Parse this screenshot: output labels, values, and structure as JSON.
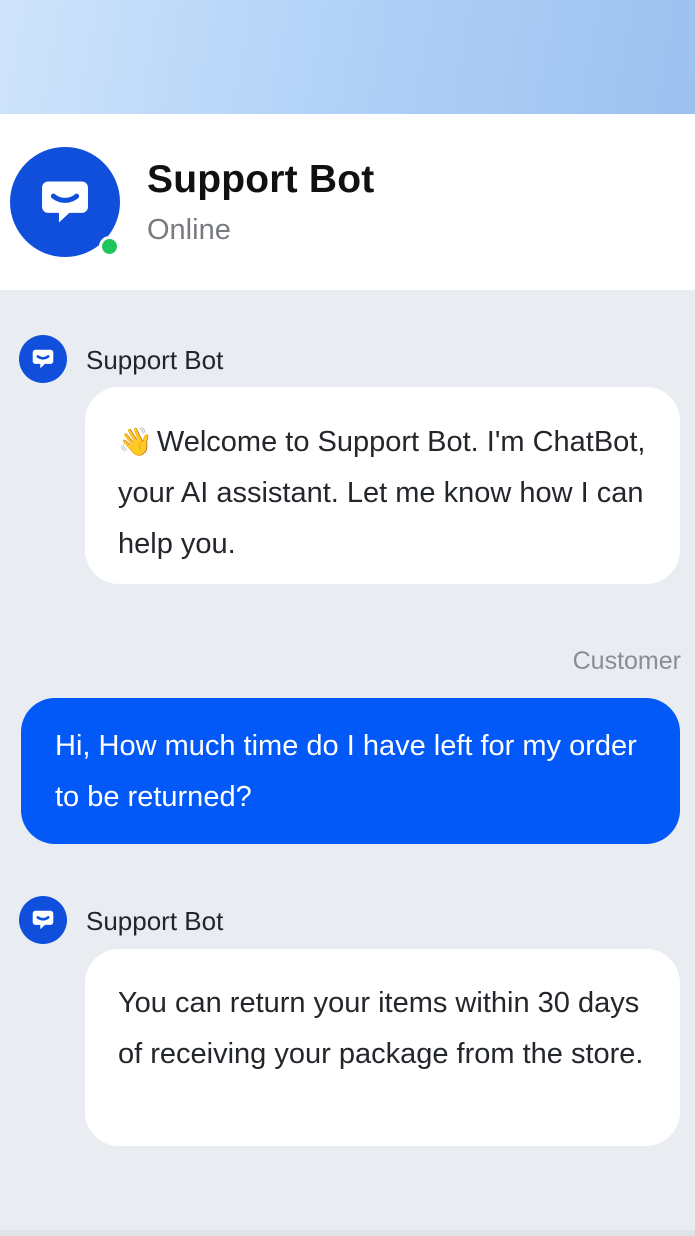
{
  "header": {
    "title": "Support Bot",
    "status": "Online",
    "avatar_icon": "chat-bubble-icon",
    "status_color": "#1fc45c",
    "brand_color": "#0f4fdc"
  },
  "messages": [
    {
      "sender": "Support Bot",
      "role": "bot",
      "emoji": "👋",
      "text": "Welcome to Support Bot. I'm ChatBot, your AI assistant. Let me know how I can help you."
    },
    {
      "sender": "Customer",
      "role": "customer",
      "text": "Hi, How much time do I have left for my order to be returned?"
    },
    {
      "sender": "Support Bot",
      "role": "bot",
      "text": "You can return your items within 30 days of receiving your package from the store."
    }
  ],
  "colors": {
    "user_bubble": "#0259f7",
    "chat_background": "#e9ecf1"
  }
}
